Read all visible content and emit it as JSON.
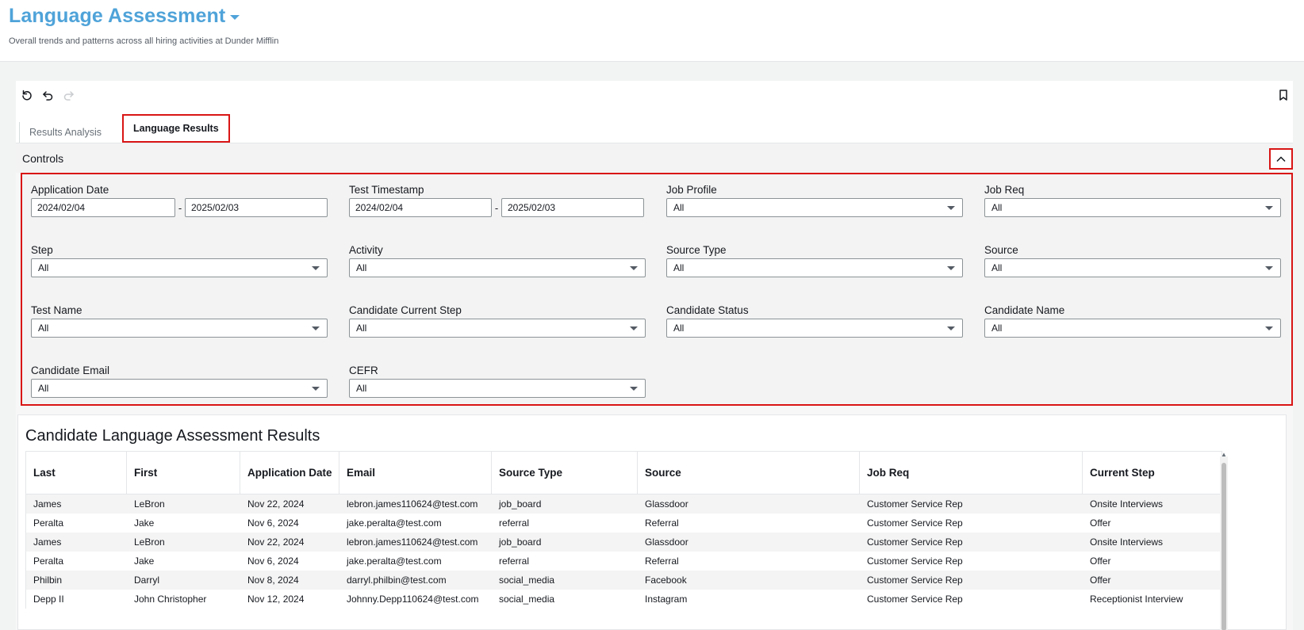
{
  "header": {
    "title": "Language Assessment",
    "subtitle": "Overall trends and patterns across all hiring activities at Dunder Mifflin"
  },
  "toolbar": {
    "icons": [
      "reset-icon",
      "undo-icon",
      "redo-icon",
      "bookmark-icon"
    ]
  },
  "tabs": [
    {
      "label": "Results Analysis",
      "active": false
    },
    {
      "label": "Language Results",
      "active": true
    }
  ],
  "controls": {
    "label": "Controls",
    "filters": {
      "application_date": {
        "label": "Application Date",
        "from": "2024/02/04",
        "to": "2025/02/03",
        "sep": "-"
      },
      "test_timestamp": {
        "label": "Test Timestamp",
        "from": "2024/02/04",
        "to": "2025/02/03",
        "sep": "-"
      },
      "job_profile": {
        "label": "Job Profile",
        "value": "All"
      },
      "job_req": {
        "label": "Job Req",
        "value": "All"
      },
      "step": {
        "label": "Step",
        "value": "All"
      },
      "activity": {
        "label": "Activity",
        "value": "All"
      },
      "source_type": {
        "label": "Source Type",
        "value": "All"
      },
      "source": {
        "label": "Source",
        "value": "All"
      },
      "test_name": {
        "label": "Test Name",
        "value": "All"
      },
      "candidate_current_step": {
        "label": "Candidate Current Step",
        "value": "All"
      },
      "candidate_status": {
        "label": "Candidate Status",
        "value": "All"
      },
      "candidate_name": {
        "label": "Candidate Name",
        "value": "All"
      },
      "candidate_email": {
        "label": "Candidate Email",
        "value": "All"
      },
      "cefr": {
        "label": "CEFR",
        "value": "All"
      }
    }
  },
  "results_table": {
    "title": "Candidate Language Assessment Results",
    "columns": [
      "Last",
      "First",
      "Application Date",
      "Email",
      "Source Type",
      "Source",
      "Job Req",
      "Current Step"
    ],
    "rows": [
      [
        "James",
        "LeBron",
        "Nov 22, 2024",
        "lebron.james110624@test.com",
        "job_board",
        "Glassdoor",
        "Customer Service Rep",
        "Onsite Interviews"
      ],
      [
        "Peralta",
        "Jake",
        "Nov 6, 2024",
        "jake.peralta@test.com",
        "referral",
        "Referral",
        "Customer Service Rep",
        "Offer"
      ],
      [
        "James",
        "LeBron",
        "Nov 22, 2024",
        "lebron.james110624@test.com",
        "job_board",
        "Glassdoor",
        "Customer Service Rep",
        "Onsite Interviews"
      ],
      [
        "Peralta",
        "Jake",
        "Nov 6, 2024",
        "jake.peralta@test.com",
        "referral",
        "Referral",
        "Customer Service Rep",
        "Offer"
      ],
      [
        "Philbin",
        "Darryl",
        "Nov 8, 2024",
        "darryl.philbin@test.com",
        "social_media",
        "Facebook",
        "Customer Service Rep",
        "Offer"
      ],
      [
        "Depp II",
        "John Christopher",
        "Nov 12, 2024",
        "Johnny.Depp110624@test.com",
        "social_media",
        "Instagram",
        "Customer Service Rep",
        "Receptionist Interview"
      ]
    ]
  }
}
